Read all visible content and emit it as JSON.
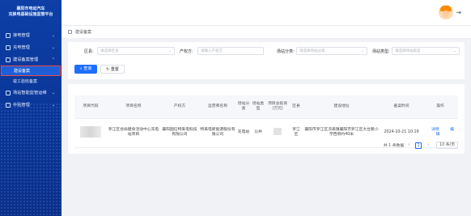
{
  "sidebar": {
    "brand_line1": "襄阳市电动汽车",
    "brand_line2": "充换电基础设施监管平台",
    "items": [
      {
        "label": "接电管理",
        "chev": "⌄"
      },
      {
        "label": "充电管理",
        "chev": "⌄"
      },
      {
        "label": "建设备案管理",
        "chev": "⌃"
      },
      {
        "label": "建设备案"
      },
      {
        "label": "竣工验收备案"
      },
      {
        "label": "场站智能监管运维",
        "chev": "⌄"
      },
      {
        "label": "补贴管理",
        "chev": "⌄"
      }
    ]
  },
  "header": {
    "logout_icon": "⇥"
  },
  "breadcrumb": {
    "text": "建设备案"
  },
  "filters": {
    "area_label": "区县:",
    "area_placeholder": "请选择区县",
    "owner_label": "产权方:",
    "owner_placeholder": "请输入产权方",
    "site_class_label": "场站分类:",
    "site_class_placeholder": "请选择场站分类",
    "site_type_label": "场站类型:",
    "site_type_placeholder": "请选择场站类型",
    "search_label": "查询",
    "reset_label": "重置"
  },
  "table": {
    "headers": [
      "项目代码",
      "项目名称",
      "产权方",
      "运营商名称",
      "场站分类",
      "场站类型",
      "项目总投资(万元)",
      "区县",
      "建设地址",
      "备案时间",
      "操作"
    ],
    "rows": [
      {
        "name": "罗江区会局健身活动中心充电站项目",
        "owner": "襄阳国信特来电科技有限公司",
        "operator": "特来电新能源股份有限公司",
        "site_class": "充电站",
        "site_type": "公共",
        "district": "罗江区",
        "address": "襄阳市罗江区凉表镇襄阳市罗江区大台路小学西侧约40米",
        "time": "2024-10-21 10:19",
        "detail": "详情",
        "edit": "编辑"
      }
    ]
  },
  "pager": {
    "total": "共 1 条数据",
    "prev": "‹",
    "page": "1",
    "next": "›",
    "size": "10 条/页"
  }
}
